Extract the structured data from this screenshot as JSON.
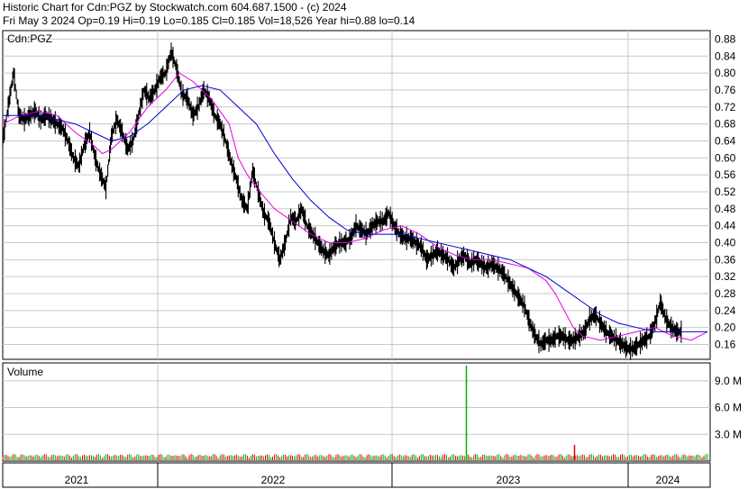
{
  "header": {
    "line1": "Historic Chart for Cdn:PGZ by Stockwatch.com 604.687.1500 - (c) 2024",
    "line2": "Fri May  3 2024  Op=0.19  Hi=0.19  Lo=0.185  Cl=0.185  Vol=18,526  Year hi=0.88  lo=0.14"
  },
  "chart_data": {
    "type": "line",
    "price_panel": {
      "symbol_label": "Cdn:PGZ",
      "ylim": [
        0.125,
        0.9
      ],
      "yticks": [
        "0.88",
        "0.84",
        "0.80",
        "0.76",
        "0.72",
        "0.68",
        "0.64",
        "0.60",
        "0.56",
        "0.52",
        "0.48",
        "0.44",
        "0.40",
        "0.36",
        "0.32",
        "0.28",
        "0.24",
        "0.20",
        "0.16"
      ],
      "grid": true,
      "series": [
        {
          "kind": "price",
          "color": "#000000",
          "x": [
            0,
            6,
            12,
            18,
            24,
            30,
            36,
            42,
            48,
            54,
            60,
            66,
            72,
            78,
            84,
            90,
            96,
            102,
            108,
            114,
            120,
            126,
            132,
            138,
            144,
            150,
            156,
            162,
            168,
            174,
            180,
            186,
            192,
            198,
            204,
            210,
            216,
            222,
            228,
            234,
            240,
            246,
            252,
            258,
            264,
            270,
            276,
            282,
            288,
            294,
            300,
            306,
            312,
            318,
            324,
            330,
            336,
            342,
            348,
            354,
            360,
            366,
            372,
            378,
            384,
            390,
            396,
            402,
            408,
            414,
            420,
            426,
            432,
            438,
            444,
            450,
            456,
            462,
            468,
            474,
            480,
            486,
            492,
            498,
            504,
            510,
            516,
            522,
            528,
            534,
            540,
            546,
            552,
            558,
            564,
            570,
            576,
            582,
            588,
            594,
            600,
            606,
            612,
            618,
            624,
            630,
            636,
            642,
            648,
            654,
            660,
            666,
            672,
            678,
            684,
            690,
            696,
            702,
            708,
            714,
            720,
            726,
            732,
            738,
            744,
            750,
            756,
            762,
            768,
            774,
            778
          ],
          "y": [
            0.64,
            0.72,
            0.8,
            0.7,
            0.69,
            0.7,
            0.71,
            0.69,
            0.7,
            0.69,
            0.68,
            0.67,
            0.64,
            0.6,
            0.58,
            0.63,
            0.66,
            0.6,
            0.56,
            0.53,
            0.65,
            0.69,
            0.66,
            0.62,
            0.64,
            0.7,
            0.76,
            0.74,
            0.76,
            0.79,
            0.8,
            0.85,
            0.81,
            0.75,
            0.74,
            0.7,
            0.72,
            0.76,
            0.74,
            0.7,
            0.68,
            0.64,
            0.59,
            0.55,
            0.5,
            0.48,
            0.57,
            0.52,
            0.47,
            0.45,
            0.4,
            0.36,
            0.4,
            0.46,
            0.45,
            0.48,
            0.44,
            0.42,
            0.4,
            0.38,
            0.37,
            0.39,
            0.4,
            0.4,
            0.41,
            0.44,
            0.43,
            0.42,
            0.44,
            0.45,
            0.45,
            0.47,
            0.44,
            0.42,
            0.41,
            0.41,
            0.4,
            0.39,
            0.36,
            0.37,
            0.38,
            0.37,
            0.36,
            0.34,
            0.36,
            0.37,
            0.35,
            0.36,
            0.35,
            0.34,
            0.35,
            0.34,
            0.33,
            0.31,
            0.29,
            0.27,
            0.25,
            0.21,
            0.18,
            0.16,
            0.17,
            0.17,
            0.18,
            0.18,
            0.17,
            0.17,
            0.18,
            0.19,
            0.22,
            0.23,
            0.21,
            0.19,
            0.18,
            0.17,
            0.16,
            0.15,
            0.15,
            0.16,
            0.17,
            0.18,
            0.21,
            0.26,
            0.22,
            0.2,
            0.19
          ]
        },
        {
          "kind": "ma_short",
          "color": "#e000e0",
          "x": [
            0,
            20,
            40,
            60,
            80,
            100,
            110,
            120,
            140,
            160,
            180,
            195,
            210,
            230,
            250,
            260,
            270,
            280,
            300,
            320,
            340,
            360,
            380,
            400,
            420,
            440,
            460,
            480,
            500,
            520,
            540,
            560,
            580,
            600,
            610,
            620,
            630,
            640,
            660,
            680,
            700,
            720,
            740,
            760,
            778
          ],
          "y": [
            0.68,
            0.7,
            0.71,
            0.7,
            0.66,
            0.63,
            0.61,
            0.62,
            0.66,
            0.72,
            0.76,
            0.8,
            0.78,
            0.74,
            0.68,
            0.6,
            0.56,
            0.53,
            0.48,
            0.45,
            0.42,
            0.4,
            0.4,
            0.41,
            0.43,
            0.44,
            0.42,
            0.39,
            0.37,
            0.36,
            0.36,
            0.35,
            0.34,
            0.31,
            0.28,
            0.24,
            0.2,
            0.18,
            0.17,
            0.18,
            0.19,
            0.2,
            0.18,
            0.17,
            0.19
          ]
        },
        {
          "kind": "ma_long",
          "color": "#0000cc",
          "x": [
            0,
            40,
            80,
            100,
            120,
            140,
            160,
            180,
            200,
            220,
            240,
            260,
            280,
            300,
            320,
            340,
            360,
            380,
            400,
            420,
            440,
            460,
            480,
            500,
            520,
            540,
            560,
            580,
            600,
            620,
            640,
            660,
            680,
            700,
            720,
            740,
            760,
            778
          ],
          "y": [
            0.7,
            0.7,
            0.68,
            0.66,
            0.64,
            0.65,
            0.68,
            0.72,
            0.76,
            0.77,
            0.76,
            0.72,
            0.68,
            0.61,
            0.55,
            0.5,
            0.46,
            0.43,
            0.42,
            0.42,
            0.42,
            0.41,
            0.4,
            0.39,
            0.38,
            0.37,
            0.36,
            0.34,
            0.32,
            0.29,
            0.26,
            0.23,
            0.21,
            0.2,
            0.19,
            0.19,
            0.19,
            0.19
          ]
        }
      ]
    },
    "volume_panel": {
      "title": "Volume",
      "ylim": [
        0,
        11000000
      ],
      "yticks": [
        "9.0 M",
        "6.0 M",
        "3.0 M"
      ],
      "ytick_values": [
        9000000,
        6000000,
        3000000
      ],
      "spike": {
        "x": 517,
        "value": 10700000,
        "color": "#00b000"
      }
    },
    "x_axis": {
      "labels": [
        "2021",
        "2022",
        "2023",
        "2024"
      ]
    }
  }
}
